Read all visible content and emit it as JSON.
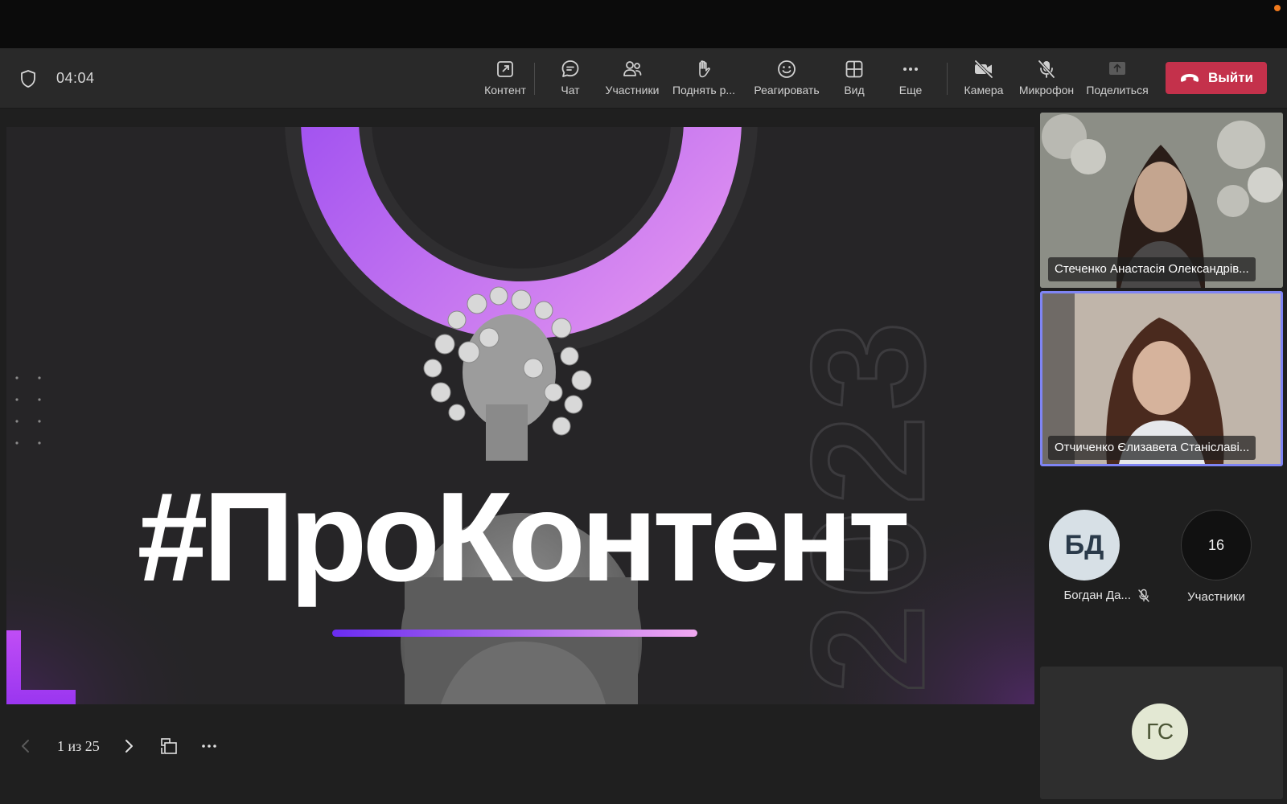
{
  "toolbar": {
    "timer": "04:04",
    "buttons": [
      {
        "label": "Контент",
        "icon": "share-tray-icon"
      },
      {
        "label": "Чат",
        "icon": "chat-icon"
      },
      {
        "label": "Участники",
        "icon": "people-icon"
      },
      {
        "label": "Поднять р...",
        "icon": "raise-hand-icon"
      },
      {
        "label": "Реагировать",
        "icon": "emoji-icon"
      },
      {
        "label": "Вид",
        "icon": "grid-icon"
      },
      {
        "label": "Еще",
        "icon": "more-icon"
      },
      {
        "label": "Камера",
        "icon": "camera-off-icon"
      },
      {
        "label": "Микрофон",
        "icon": "mic-off-icon"
      },
      {
        "label": "Поделиться",
        "icon": "share-icon"
      }
    ],
    "leave_label": "Выйти"
  },
  "slide": {
    "title": "#ПроКонтент",
    "year": "2023",
    "page_indicator": "1 из 25"
  },
  "participants": {
    "video_tiles": [
      {
        "name": "Стеченко Анастасія Олександрів...",
        "active_speaker": false
      },
      {
        "name": "Отчиченко Єлизавета Станіславі...",
        "active_speaker": true
      }
    ],
    "avatar_person": {
      "initials": "БД",
      "name": "Богдан Да...",
      "muted": true
    },
    "participants_count": {
      "count": "16",
      "label": "Участники"
    },
    "bottom_tile": {
      "initials": "ГС"
    }
  },
  "colors": {
    "leave_button": "#c4314b",
    "active_speaker_border": "#7f85f5",
    "ring_gradient_start": "#8a3bf0",
    "ring_gradient_end": "#e99af0"
  }
}
